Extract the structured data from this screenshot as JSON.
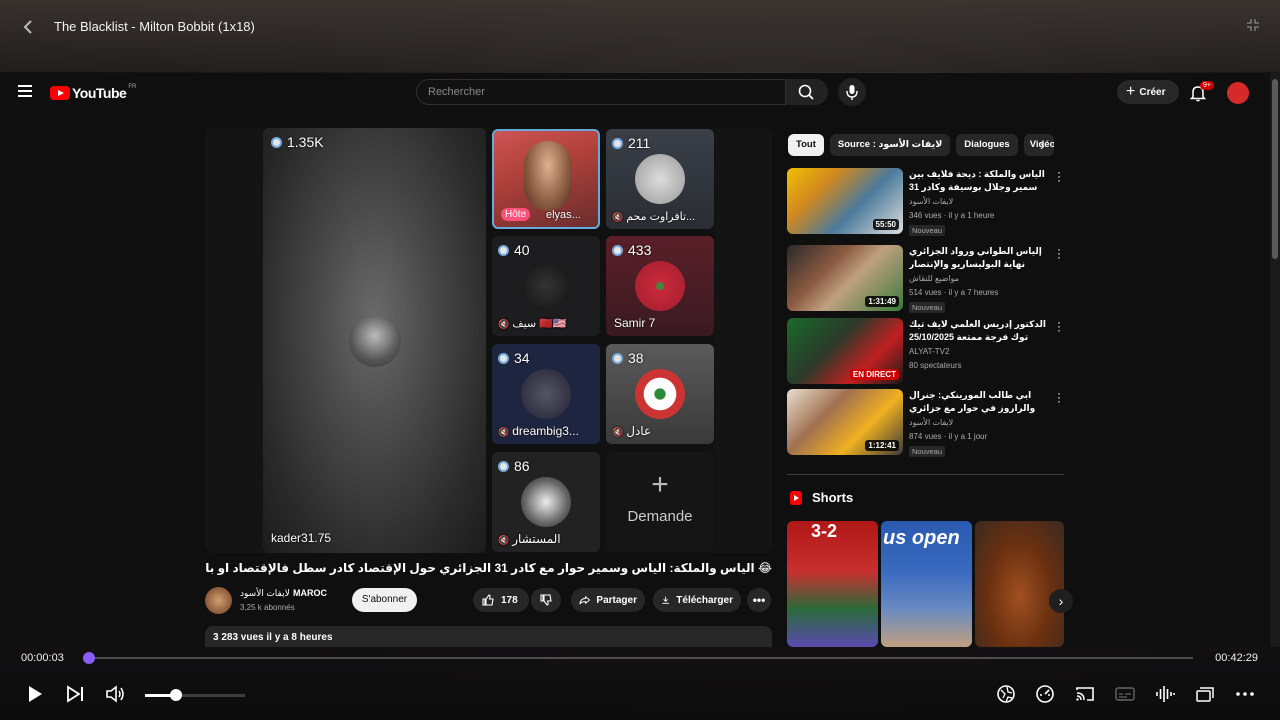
{
  "player": {
    "title": "The Blacklist - Milton Bobbit (1x18)",
    "time_current": "00:00:03",
    "time_total": "00:42:29",
    "progress": 0.001,
    "volume": 0.31
  },
  "youtube": {
    "logo": "YouTube",
    "region": "FR",
    "search_placeholder": "Rechercher",
    "create_label": "Créer",
    "notif_badge": "9+",
    "video": {
      "tiles": [
        {
          "count": "1.35K",
          "name": "kader31.75"
        },
        {
          "count": "",
          "name": "elyas...",
          "host": "Hôte"
        },
        {
          "count": "211",
          "name": "تافراوت محم..."
        },
        {
          "count": "40",
          "name": "سيف 🇲🇦🇺🇸"
        },
        {
          "count": "433",
          "name": "Samir 7"
        },
        {
          "count": "34",
          "name": "dreambig3..."
        },
        {
          "count": "38",
          "name": "عادل"
        },
        {
          "count": "86",
          "name": "المستشار"
        }
      ],
      "demande_label": "Demande",
      "title": "😂 الياس والملكة: الياس وسمير حوار مع كادر 31 الجزائري حول الإقتصاد كادر سطل فالإقتصاد او باغي يناضر",
      "channel_name": "لايفات الأسود",
      "channel_tag": "MAROC",
      "subscribers": "3,25 k abonnés",
      "subscribe_label": "S'abonner",
      "likes": "178",
      "share_label": "Partager",
      "download_label": "Télécharger",
      "views_info": "3 283 vues  il y a 8 heures"
    },
    "chips": [
      "Tout",
      "Source : لايفات الأسود",
      "Dialogues",
      "Vidéo"
    ],
    "recommendations": [
      {
        "title": "الياس والملكة : ديحة فلايف بين سمير وجلال بوسيفة وكادر 31 حول الإقتصاد ...",
        "channel": "لايفات الأسود",
        "meta": "346 vues · il y a 1 heure",
        "duration": "55:50",
        "badge": "Nouveau"
      },
      {
        "title": "إلياس الطواني ورواد الجزائري نهاية البوليساريو والإنتصار المغرب على الكراطة",
        "channel": "مواضيع للنقاش",
        "meta": "514 vues · il y a 7 heures",
        "duration": "1:31:49",
        "badge": "Nouveau"
      },
      {
        "title": "الدكتور إدريس العلمي لايف تيك توك فرجة ممتعة 25/10/2025",
        "channel": "ALYAT-TV2",
        "meta": "80 spectateurs",
        "duration": "EN DIRECT",
        "badge": ""
      },
      {
        "title": "ابي طالب المورينكي: جنرال والراروز في حوار مع جزائري بروبريرة هل ستقبل الجزائر ...",
        "channel": "لايفات الأسود",
        "meta": "874 vues · il y a 1 jour",
        "duration": "1:12:41",
        "badge": "Nouveau"
      }
    ],
    "shorts_label": "Shorts",
    "shorts": [
      {
        "text": "3-2"
      },
      {
        "text": "us open"
      },
      {
        "text": ""
      }
    ]
  }
}
